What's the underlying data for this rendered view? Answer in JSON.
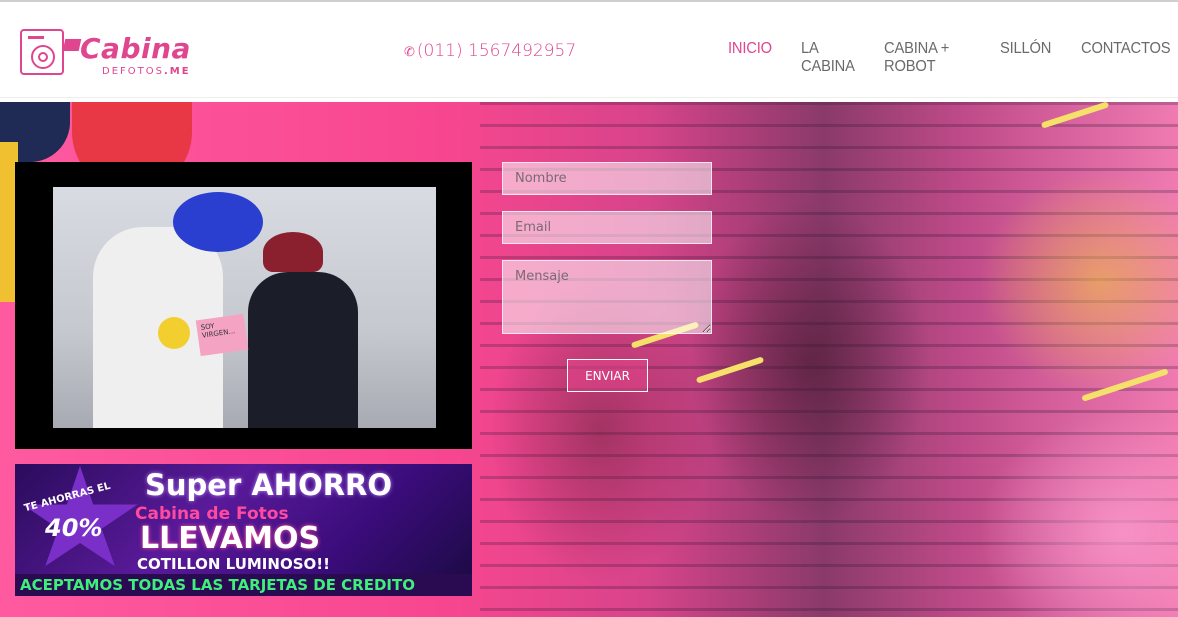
{
  "header": {
    "logo_title": "Cabina",
    "logo_sub_prefix": "DEFOTOS",
    "logo_sub_suffix": ".ME",
    "phone_icon": "phone-icon",
    "phone": "(011) 1567492957",
    "nav": [
      {
        "label": "INICIO",
        "active": true
      },
      {
        "label": "LA CABINA",
        "active": false
      },
      {
        "label": "CABINA + ROBOT",
        "active": false
      },
      {
        "label": "SILLÓN",
        "active": false
      },
      {
        "label": "CONTACTOS",
        "active": false
      }
    ]
  },
  "video": {
    "sign_text": "SOY VIRGEN..."
  },
  "promo": {
    "save_label": "TE AHORRAS EL",
    "percent": "40%",
    "headline": "Super AHORRO",
    "subheadline": "Cabina de Fotos",
    "llevamos": "LLEVAMOS",
    "cotillon": "COTILLON LUMINOSO!!",
    "cards": "ACEPTAMOS TODAS LAS TARJETAS DE CREDITO"
  },
  "form": {
    "name_placeholder": "Nombre",
    "email_placeholder": "Email",
    "message_placeholder": "Mensaje",
    "submit_label": "ENVIAR"
  },
  "colors": {
    "accent": "#e0468f",
    "nav_text": "#6a6a6a",
    "promo_green": "#3df07a"
  }
}
